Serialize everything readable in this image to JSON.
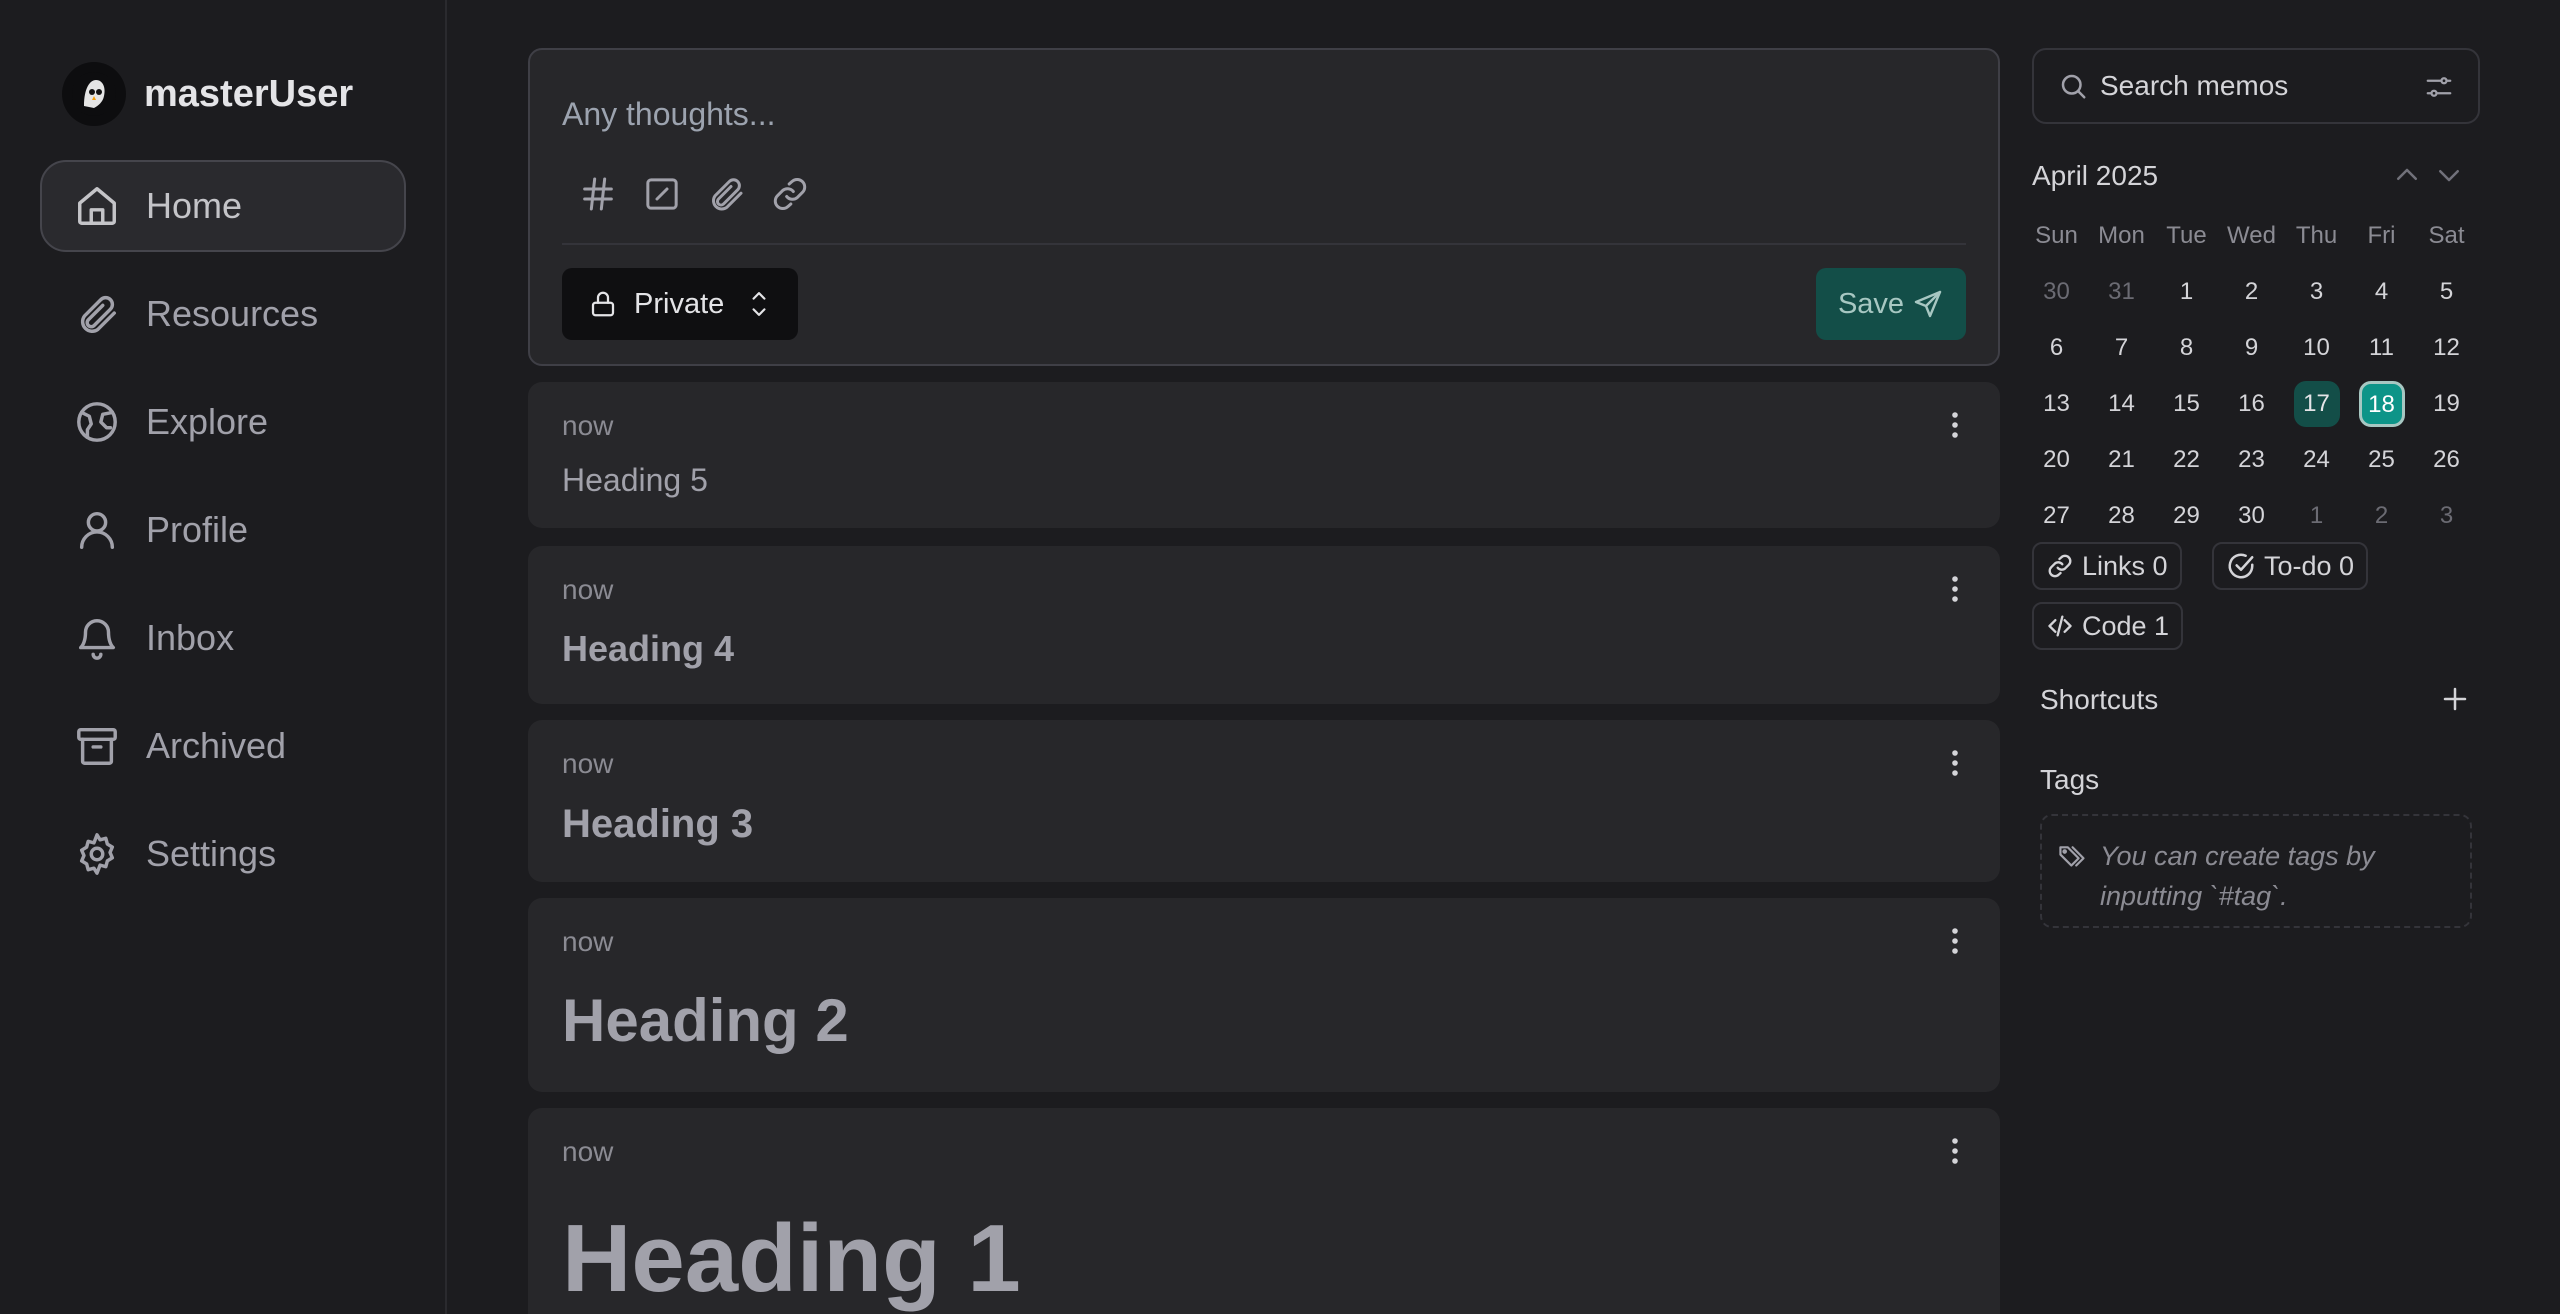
{
  "user": {
    "name": "masterUser"
  },
  "nav": [
    {
      "label": "Home",
      "icon": "home-icon",
      "active": true
    },
    {
      "label": "Resources",
      "icon": "paperclip-icon"
    },
    {
      "label": "Explore",
      "icon": "globe-icon"
    },
    {
      "label": "Profile",
      "icon": "user-icon"
    },
    {
      "label": "Inbox",
      "icon": "bell-icon"
    },
    {
      "label": "Archived",
      "icon": "archive-icon"
    },
    {
      "label": "Settings",
      "icon": "gear-icon"
    }
  ],
  "composer": {
    "placeholder": "Any thoughts...",
    "visibility": "Private",
    "save_label": "Save"
  },
  "memos": [
    {
      "time": "now",
      "title": "Heading 5"
    },
    {
      "time": "now",
      "title": "Heading 4"
    },
    {
      "time": "now",
      "title": "Heading 3"
    },
    {
      "time": "now",
      "title": "Heading 2"
    },
    {
      "time": "now",
      "title": "Heading 1"
    }
  ],
  "search": {
    "placeholder": "Search memos"
  },
  "calendar": {
    "title": "April 2025",
    "weekdays": [
      "Sun",
      "Mon",
      "Tue",
      "Wed",
      "Thu",
      "Fri",
      "Sat"
    ],
    "weeks": [
      [
        "30",
        "31",
        "1",
        "2",
        "3",
        "4",
        "5"
      ],
      [
        "6",
        "7",
        "8",
        "9",
        "10",
        "11",
        "12"
      ],
      [
        "13",
        "14",
        "15",
        "16",
        "17",
        "18",
        "19"
      ],
      [
        "20",
        "21",
        "22",
        "23",
        "24",
        "25",
        "26"
      ],
      [
        "27",
        "28",
        "29",
        "30",
        "1",
        "2",
        "3"
      ]
    ],
    "today": "17",
    "selected": "18"
  },
  "stats": {
    "links": "Links 0",
    "todo": "To-do 0",
    "code": "Code 1"
  },
  "shortcuts": {
    "title": "Shortcuts"
  },
  "tags": {
    "title": "Tags",
    "hint": "You can create tags by inputting `#tag`."
  },
  "colors": {
    "accent": "#0d9488",
    "accent_dark": "#134e48",
    "bg": "#1c1c1f",
    "card": "#27272a"
  }
}
